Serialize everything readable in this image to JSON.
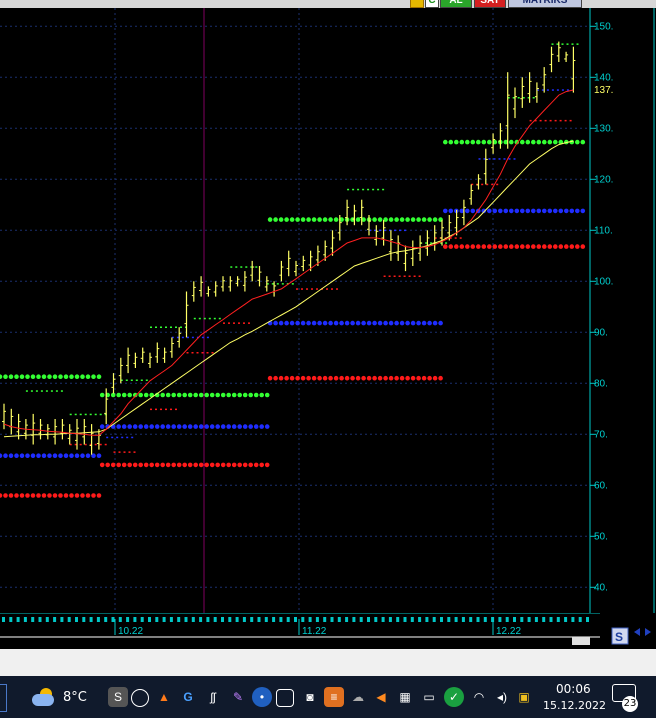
{
  "toolbar": {
    "buttons": [
      "AL",
      "SAT",
      "MATRIKS"
    ],
    "colors": {
      "al": "#2aa52a",
      "sat": "#d42020",
      "matriks": "#c0c8e0"
    }
  },
  "chart_data": {
    "type": "line",
    "yaxis": {
      "ticks": [
        "150.",
        "140.",
        "130.",
        "120.",
        "110.",
        "100.",
        "90.",
        "80.",
        "70.",
        "60.",
        "50.",
        "40."
      ],
      "tick_values": [
        150,
        140,
        130,
        120,
        110,
        100,
        90,
        80,
        70,
        60,
        50,
        40
      ],
      "ylim": [
        35,
        152
      ],
      "current_price_label": "137.",
      "current_price": 137.5
    },
    "xaxis": {
      "tick_labels": [
        "10.22",
        "11.22",
        "12.22"
      ]
    },
    "grid": true,
    "background": "#000000",
    "colors": {
      "price_bars": "#ffff66",
      "ma_fast": "#ff2020",
      "ma_slow": "#ffff66",
      "level_green": "#33ff33",
      "level_blue": "#1f2dff",
      "level_red": "#ff1a1a",
      "axis": "#00c8c8",
      "grid": "#1b2f6e",
      "marker": "#800060"
    },
    "bars": [
      [
        76,
        71
      ],
      [
        75,
        70
      ],
      [
        74,
        69
      ],
      [
        73,
        69
      ],
      [
        74,
        68
      ],
      [
        73,
        69
      ],
      [
        72,
        69
      ],
      [
        73,
        68
      ],
      [
        73,
        69
      ],
      [
        72,
        68
      ],
      [
        73,
        67
      ],
      [
        73,
        68
      ],
      [
        72,
        66
      ],
      [
        71,
        67
      ],
      [
        79,
        72
      ],
      [
        82,
        78
      ],
      [
        85,
        80
      ],
      [
        87,
        82
      ],
      [
        86,
        83
      ],
      [
        87,
        84
      ],
      [
        86,
        83
      ],
      [
        88,
        84
      ],
      [
        87,
        84
      ],
      [
        89,
        85
      ],
      [
        91,
        87
      ],
      [
        98,
        89
      ],
      [
        100,
        96
      ],
      [
        101,
        97
      ],
      [
        99,
        97
      ],
      [
        100,
        97
      ],
      [
        101,
        98
      ],
      [
        101,
        98
      ],
      [
        101,
        99
      ],
      [
        102,
        98
      ],
      [
        104,
        100
      ],
      [
        103,
        99
      ],
      [
        101,
        98
      ],
      [
        100,
        97
      ],
      [
        104,
        100
      ],
      [
        106,
        101
      ],
      [
        104,
        101
      ],
      [
        105,
        102
      ],
      [
        106,
        102
      ],
      [
        107,
        103
      ],
      [
        108,
        104
      ],
      [
        110,
        105
      ],
      [
        113,
        108
      ],
      [
        116,
        111
      ],
      [
        115,
        111
      ],
      [
        116,
        111
      ],
      [
        113,
        109
      ],
      [
        111,
        107
      ],
      [
        112,
        107
      ],
      [
        110,
        104
      ],
      [
        109,
        104
      ],
      [
        107,
        102
      ],
      [
        108,
        103
      ],
      [
        109,
        104
      ],
      [
        110,
        105
      ],
      [
        111,
        106
      ],
      [
        112,
        107
      ],
      [
        113,
        108
      ],
      [
        114,
        109
      ],
      [
        116,
        111
      ],
      [
        119,
        115
      ],
      [
        121,
        118
      ],
      [
        126,
        119
      ],
      [
        129,
        125
      ],
      [
        131,
        126
      ],
      [
        141,
        126
      ],
      [
        138,
        132
      ],
      [
        140,
        134
      ],
      [
        141,
        135
      ],
      [
        139,
        135
      ],
      [
        142,
        137
      ],
      [
        146,
        141
      ],
      [
        147,
        143
      ],
      [
        145,
        143
      ],
      [
        146,
        137
      ]
    ],
    "ma_fast": [
      72,
      71.5,
      71.2,
      71,
      70.9,
      70.8,
      70.6,
      70.5,
      70.4,
      70.2,
      70.1,
      70,
      69.8,
      69.8,
      71,
      72.5,
      74,
      76,
      77.5,
      79,
      80.5,
      81.5,
      82.5,
      83.5,
      85,
      86.5,
      88,
      89.5,
      90.5,
      91.5,
      92.5,
      93.5,
      94.5,
      95.5,
      96.5,
      97,
      97.5,
      98,
      98.5,
      99.5,
      100.5,
      101.5,
      102.5,
      103.5,
      104.5,
      105.5,
      106.5,
      107.5,
      108,
      108.5,
      108.5,
      108.5,
      108.2,
      107.8,
      107.4,
      106.8,
      106.6,
      106.6,
      106.8,
      107.2,
      107.8,
      108.5,
      109.5,
      110.5,
      112,
      114,
      116,
      118.5,
      121,
      124,
      126.5,
      128.5,
      130.5,
      132,
      133.5,
      135,
      136.5,
      137.2,
      137.5
    ],
    "ma_slow": [
      69.5,
      69.6,
      69.7,
      69.8,
      69.9,
      69.9,
      70,
      70,
      70.1,
      70.2,
      70.2,
      70.3,
      70.4,
      70.5,
      71,
      72,
      73,
      74,
      75,
      76,
      77,
      78,
      79,
      80,
      81,
      82,
      83,
      84,
      85,
      86,
      87,
      88,
      88.7,
      89.5,
      90.2,
      91,
      91.8,
      92.6,
      93.4,
      94.2,
      95,
      96,
      97,
      98,
      99,
      100,
      101,
      102,
      103,
      103.5,
      104,
      104.5,
      105,
      105.5,
      105.8,
      106,
      106.3,
      106.6,
      107,
      107.5,
      108,
      108.8,
      109.5,
      110.5,
      111.5,
      112.5,
      114,
      115.5,
      117,
      118.5,
      120,
      121.5,
      123,
      124,
      125,
      126,
      126.8,
      127.2,
      127.5
    ],
    "levels": [
      {
        "color": "level_green",
        "value": 81.3,
        "from": 0,
        "to": 13
      },
      {
        "color": "level_blue",
        "value": 65.8,
        "from": 0,
        "to": 13
      },
      {
        "color": "level_red",
        "value": 58.0,
        "from": 0,
        "to": 13
      },
      {
        "color": "level_green",
        "value": 77.7,
        "from": 14,
        "to": 36
      },
      {
        "color": "level_blue",
        "value": 71.5,
        "from": 14,
        "to": 36
      },
      {
        "color": "level_red",
        "value": 64.0,
        "from": 14,
        "to": 36
      },
      {
        "color": "level_green",
        "value": 112.1,
        "from": 37,
        "to": 60
      },
      {
        "color": "level_blue",
        "value": 91.8,
        "from": 37,
        "to": 60
      },
      {
        "color": "level_red",
        "value": 81.0,
        "from": 37,
        "to": 60
      },
      {
        "color": "level_green",
        "value": 127.3,
        "from": 61,
        "to": 79
      },
      {
        "color": "level_blue",
        "value": 113.8,
        "from": 61,
        "to": 79
      },
      {
        "color": "level_red",
        "value": 106.8,
        "from": 61,
        "to": 79
      }
    ],
    "minor_levels": [
      {
        "color": "level_green",
        "value": 78.5,
        "from": 3,
        "to": 8
      },
      {
        "color": "level_green",
        "value": 73.9,
        "from": 9,
        "to": 14
      },
      {
        "color": "level_red",
        "value": 68.0,
        "from": 9,
        "to": 14
      },
      {
        "color": "level_blue",
        "value": 69.4,
        "from": 14,
        "to": 18
      },
      {
        "color": "level_red",
        "value": 66.5,
        "from": 15,
        "to": 18
      },
      {
        "color": "level_green",
        "value": 80.6,
        "from": 16,
        "to": 20
      },
      {
        "color": "level_red",
        "value": 74.9,
        "from": 20,
        "to": 24
      },
      {
        "color": "level_green",
        "value": 91.0,
        "from": 20,
        "to": 25
      },
      {
        "color": "level_blue",
        "value": 89.0,
        "from": 23,
        "to": 28
      },
      {
        "color": "level_red",
        "value": 86.0,
        "from": 25,
        "to": 29
      },
      {
        "color": "level_green",
        "value": 92.7,
        "from": 26,
        "to": 30
      },
      {
        "color": "level_red",
        "value": 91.8,
        "from": 30,
        "to": 34
      },
      {
        "color": "level_green",
        "value": 102.8,
        "from": 31,
        "to": 35
      },
      {
        "color": "level_green",
        "value": 99.5,
        "from": 36,
        "to": 40
      },
      {
        "color": "level_red",
        "value": 98.5,
        "from": 40,
        "to": 46
      },
      {
        "color": "level_green",
        "value": 118.0,
        "from": 47,
        "to": 52
      },
      {
        "color": "level_blue",
        "value": 110.0,
        "from": 50,
        "to": 55
      },
      {
        "color": "level_red",
        "value": 101.0,
        "from": 52,
        "to": 57
      },
      {
        "color": "level_green",
        "value": 107.5,
        "from": 57,
        "to": 61
      },
      {
        "color": "level_red",
        "value": 108.5,
        "from": 59,
        "to": 63
      },
      {
        "color": "level_red",
        "value": 119.0,
        "from": 64,
        "to": 68
      },
      {
        "color": "level_blue",
        "value": 124.0,
        "from": 65,
        "to": 70
      },
      {
        "color": "level_green",
        "value": 136.0,
        "from": 69,
        "to": 73
      },
      {
        "color": "level_blue",
        "value": 137.5,
        "from": 73,
        "to": 78
      },
      {
        "color": "level_red",
        "value": 131.5,
        "from": 72,
        "to": 78
      },
      {
        "color": "level_green",
        "value": 146.5,
        "from": 75,
        "to": 79
      }
    ]
  },
  "taskbar": {
    "weather_temp": "8°C",
    "time": "00:06",
    "date": "15.12.2022",
    "notification_count": "23",
    "tray_icons": [
      "search-icon",
      "globe-icon",
      "flame-icon",
      "g-letter-icon",
      "font-icon",
      "pen-icon",
      "app-icon",
      "screenshot-icon",
      "camera-icon",
      "stack-icon",
      "cloud-icon",
      "speaker-cone-icon",
      "keyboard-icon",
      "battery-icon",
      "shield-check-icon",
      "wifi-icon",
      "volume-icon",
      "lock-icon"
    ]
  }
}
